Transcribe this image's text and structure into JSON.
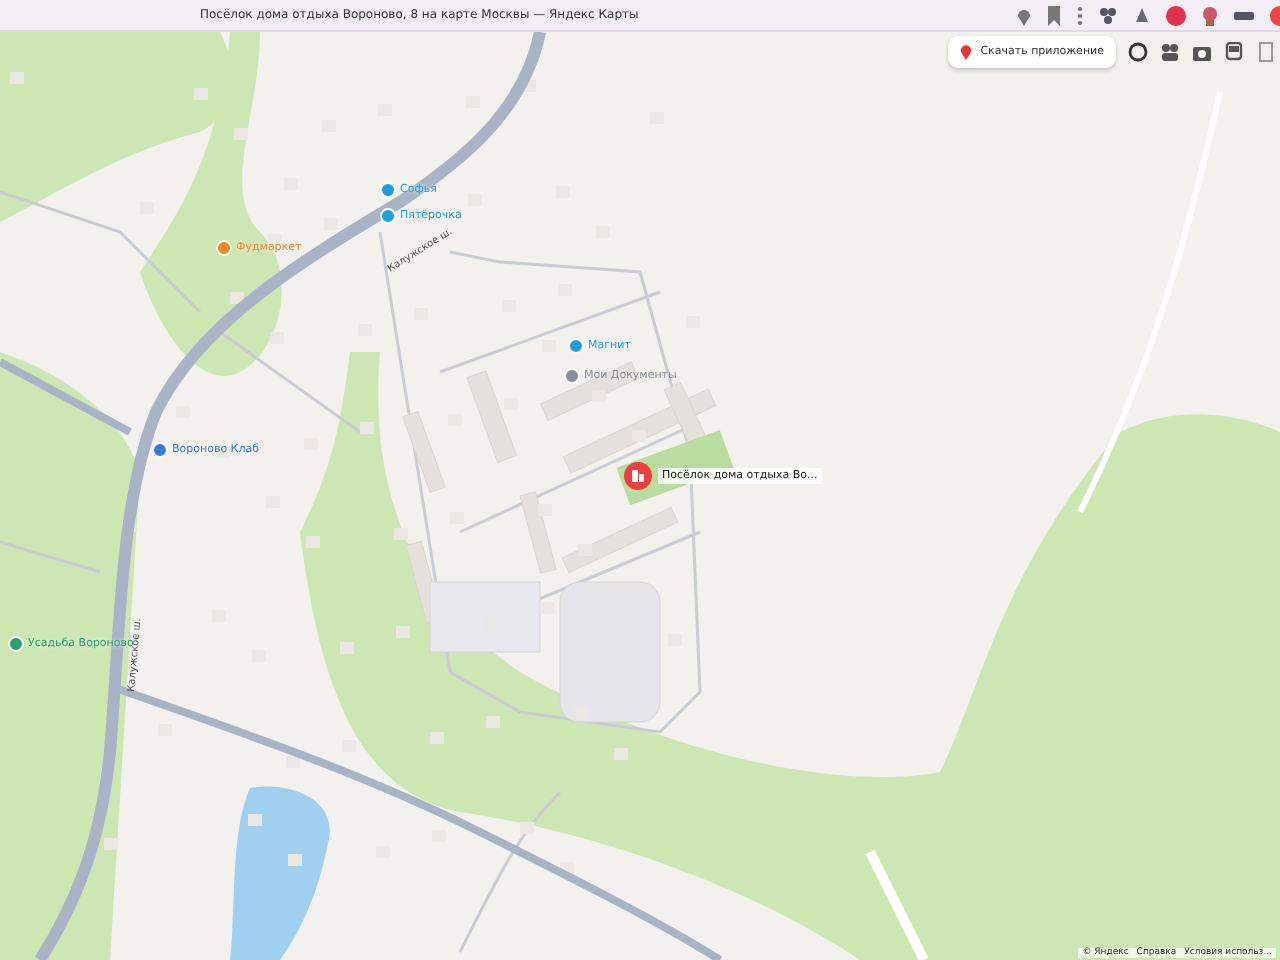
{
  "browser": {
    "title": "Посёлок дома отдыха Вороново, 8 на карте Москвы — Яндекс Карты"
  },
  "map": {
    "download_button": "Скачать приложение",
    "road_labels": [
      "Калужское ш.",
      "Калужское ш."
    ],
    "pois": [
      {
        "label": "Софья",
        "color": "#1a9fd9"
      },
      {
        "label": "Пятёрочка",
        "color": "#1a9fd9"
      },
      {
        "label": "Фудмаркет",
        "color": "#f08a24"
      },
      {
        "label": "Магнит",
        "color": "#1a9fd9"
      },
      {
        "label": "Мои Документы",
        "color": "#8a8f99"
      },
      {
        "label": "Вороново Клаб",
        "color": "#3a7bd5"
      },
      {
        "label": "Усадьба Вороново",
        "color": "#2aa36b"
      }
    ],
    "marker": {
      "label": "Посёлок дома отдыха Во..."
    },
    "attribution": [
      "© Яндекс",
      "Справка",
      "Условия использ..."
    ]
  }
}
